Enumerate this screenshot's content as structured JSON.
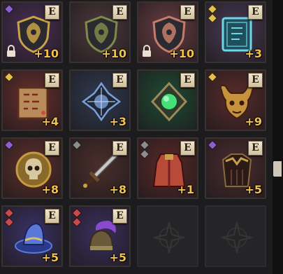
{
  "inventory": {
    "slots": [
      {
        "id": "lion-crest-shield-violet",
        "level": "+10",
        "badge": "E",
        "locked": true,
        "gems": [
          "#8a5fd0"
        ],
        "bg": "#4a2f57",
        "art": "shield",
        "accent": "#c9a24a"
      },
      {
        "id": "lion-crest-shield-olive",
        "level": "+10",
        "badge": "E",
        "locked": false,
        "gems": [],
        "bg": "#4d3a3c",
        "art": "shield",
        "accent": "#7f8a4a"
      },
      {
        "id": "lion-crest-shield-rose",
        "level": "+10",
        "badge": "E",
        "locked": true,
        "gems": [],
        "bg": "#6a3e45",
        "art": "shield",
        "accent": "#c57d6a"
      },
      {
        "id": "frost-rune-tome",
        "level": "+3",
        "badge": "E",
        "locked": false,
        "gems": [
          "#e2c04a",
          "#e2c04a"
        ],
        "bg": "#4a3a56",
        "art": "tome",
        "accent": "#6fd6e6"
      },
      {
        "id": "runed-grimoire",
        "level": "+4",
        "badge": "E",
        "locked": false,
        "gems": [
          "#e2c04a"
        ],
        "bg": "#6a2f2e",
        "art": "book",
        "accent": "#b86a4a"
      },
      {
        "id": "spiked-blue-emblem",
        "level": "+3",
        "badge": "E",
        "locked": false,
        "gems": [],
        "bg": "#2f3a52",
        "art": "emblem",
        "accent": "#7aa0d8"
      },
      {
        "id": "emerald-amulet",
        "level": "",
        "badge": "E",
        "locked": false,
        "gems": [],
        "bg": "#1f4a34",
        "art": "amulet",
        "accent": "#44e07a"
      },
      {
        "id": "horned-demon-mask",
        "level": "+9",
        "badge": "E",
        "locked": false,
        "gems": [
          "#e2c04a"
        ],
        "bg": "#5a2b2a",
        "art": "mask",
        "accent": "#c8913e"
      },
      {
        "id": "skull-medallion",
        "level": "+8",
        "badge": "E",
        "locked": false,
        "gems": [
          "#8a5fd0"
        ],
        "bg": "#5e2f2c",
        "art": "skull",
        "accent": "#c79a3e"
      },
      {
        "id": "steel-longsword",
        "level": "+8",
        "badge": "E",
        "locked": false,
        "gems": [
          "#8d8d8d"
        ],
        "bg": "#4a2e2b",
        "art": "sword",
        "accent": "#c8c8c8"
      },
      {
        "id": "crimson-mantle",
        "level": "+1",
        "badge": "E",
        "locked": false,
        "gems": [
          "#8d8d8d",
          "#8d8d8d"
        ],
        "bg": "#5a2828",
        "art": "cloak",
        "accent": "#b84a3a"
      },
      {
        "id": "bronze-pauldron-cape",
        "level": "+5",
        "badge": "E",
        "locked": false,
        "gems": [
          "#8a5fd0"
        ],
        "bg": "#4a2b2e",
        "art": "cape",
        "accent": "#8a6a3a"
      },
      {
        "id": "sapphire-wide-hat",
        "level": "+5",
        "badge": "E",
        "locked": false,
        "gems": [
          "#c84a4a",
          "#c84a4a"
        ],
        "bg": "#3a3266",
        "art": "hat",
        "accent": "#5b78d8"
      },
      {
        "id": "plumed-war-helm",
        "level": "+5",
        "badge": "E",
        "locked": false,
        "gems": [
          "#c84a4a",
          "#c84a4a"
        ],
        "bg": "#3a2f5e",
        "art": "helm",
        "accent": "#8a4ad0"
      },
      {
        "id": "empty-slot-1",
        "empty": true
      },
      {
        "id": "empty-slot-2",
        "empty": true
      }
    ]
  }
}
